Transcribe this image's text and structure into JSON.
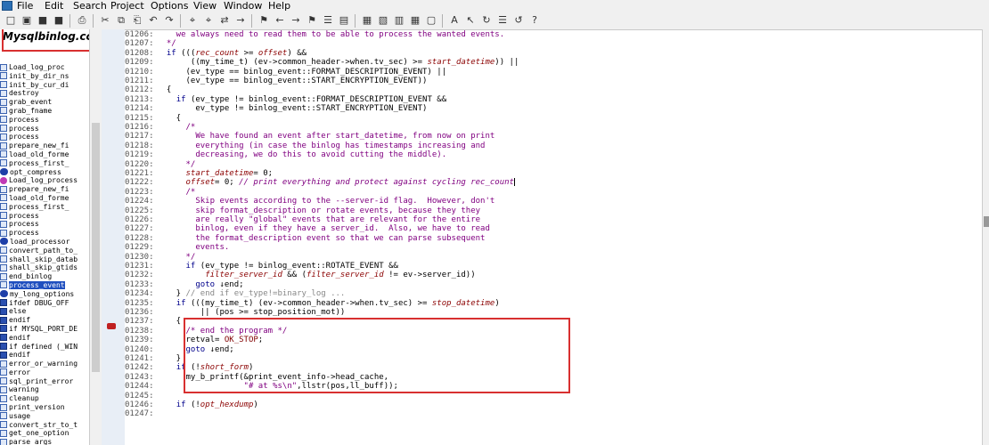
{
  "menu": [
    "File",
    "Edit",
    "Search",
    "Project",
    "Options",
    "View",
    "Window",
    "Help"
  ],
  "file_title": "Mysqlbinlog.cc",
  "sidebar_items": [
    {
      "label": "Load_log_proc",
      "kind": "blue"
    },
    {
      "label": "init_by_dir_ns",
      "kind": "blue"
    },
    {
      "label": "init_by_cur_di",
      "kind": "blue"
    },
    {
      "label": "destroy",
      "kind": "blue"
    },
    {
      "label": "grab_event",
      "kind": "blue"
    },
    {
      "label": "grab_fname",
      "kind": "blue"
    },
    {
      "label": "process",
      "kind": "blue"
    },
    {
      "label": "process",
      "kind": "blue"
    },
    {
      "label": "process",
      "kind": "blue"
    },
    {
      "label": "prepare_new_fi",
      "kind": "blue"
    },
    {
      "label": "load_old_forme",
      "kind": "blue"
    },
    {
      "label": "process_first_",
      "kind": "blue"
    },
    {
      "label": "opt_compress",
      "kind": "oval"
    },
    {
      "label": "Load_log_process",
      "kind": "purple"
    },
    {
      "label": "prepare_new_fi",
      "kind": "blue"
    },
    {
      "label": "load_old_forme",
      "kind": "blue"
    },
    {
      "label": "process_first_",
      "kind": "blue"
    },
    {
      "label": "process",
      "kind": "blue"
    },
    {
      "label": "process",
      "kind": "blue"
    },
    {
      "label": "process",
      "kind": "blue"
    },
    {
      "label": "load_processor",
      "kind": "oval"
    },
    {
      "label": "convert_path_to_",
      "kind": "blue"
    },
    {
      "label": "shall_skip_datab",
      "kind": "blue"
    },
    {
      "label": "shall_skip_gtids",
      "kind": "blue"
    },
    {
      "label": "end_binlog",
      "kind": "blue"
    },
    {
      "label": "process_event",
      "kind": "blue",
      "selected": true
    },
    {
      "label": "my_long_options",
      "kind": "oval"
    },
    {
      "label": "ifdef DBUG_OFF",
      "kind": "hash"
    },
    {
      "label": "else",
      "kind": "hash"
    },
    {
      "label": "endif",
      "kind": "hash"
    },
    {
      "label": "if MYSQL_PORT_DE",
      "kind": "hash"
    },
    {
      "label": "endif",
      "kind": "hash"
    },
    {
      "label": "if defined (_WIN",
      "kind": "hash"
    },
    {
      "label": "endif",
      "kind": "hash"
    },
    {
      "label": "error_or_warning",
      "kind": "blue"
    },
    {
      "label": "error",
      "kind": "blue"
    },
    {
      "label": "sql_print_error",
      "kind": "blue"
    },
    {
      "label": "warning",
      "kind": "blue"
    },
    {
      "label": "cleanup",
      "kind": "blue"
    },
    {
      "label": "print_version",
      "kind": "blue"
    },
    {
      "label": "usage",
      "kind": "blue"
    },
    {
      "label": "convert_str_to_t",
      "kind": "blue"
    },
    {
      "label": "get_one_option",
      "kind": "blue"
    },
    {
      "label": "parse_args",
      "kind": "blue"
    }
  ],
  "code_lines": [
    {
      "n": "01206:",
      "html": "    we always need to read them to be able to process the wanted events.",
      "cls": "cm"
    },
    {
      "n": "01207:",
      "html": "  */",
      "cls": "cm"
    },
    {
      "n": "01208:",
      "html": "  <span class=\"tok-kw\">if</span> (((<span class=\"tok-var\">rec_count</span> >= <span class=\"tok-var\">offset</span>) &&"
    },
    {
      "n": "01209:",
      "html": "       ((my_time_t) (ev->common_header->when.tv_sec) >= <span class=\"tok-var\">start_datetime</span>)) ||"
    },
    {
      "n": "01210:",
      "html": "      (ev_type == binlog_event::FORMAT_DESCRIPTION_EVENT) ||"
    },
    {
      "n": "01211:",
      "html": "      (ev_type == binlog_event::START_ENCRYPTION_EVENT))"
    },
    {
      "n": "01212:",
      "html": "  {"
    },
    {
      "n": "01213:",
      "html": "    <span class=\"tok-kw\">if</span> (ev_type != binlog_event::FORMAT_DESCRIPTION_EVENT &&"
    },
    {
      "n": "01214:",
      "html": "        ev_type != binlog_event::START_ENCRYPTION_EVENT)"
    },
    {
      "n": "01215:",
      "html": "    {"
    },
    {
      "n": "01216:",
      "html": "      /*",
      "cls": "cm"
    },
    {
      "n": "01217:",
      "html": "        We have found an event after start_datetime, from now on print",
      "cls": "cm"
    },
    {
      "n": "01218:",
      "html": "        everything (in case the binlog has timestamps increasing and",
      "cls": "cm"
    },
    {
      "n": "01219:",
      "html": "        decreasing, we do this to avoid cutting the middle).",
      "cls": "cm"
    },
    {
      "n": "01220:",
      "html": "      */",
      "cls": "cm"
    },
    {
      "n": "01221:",
      "html": "      <span class=\"tok-var\">start_datetime</span>= 0;"
    },
    {
      "n": "01222:",
      "html": "      <span class=\"tok-var\">offset</span>= 0; <span class=\"tok-cm\" style=\"font-style:italic\">// print everything and protect against cycling rec_count</span><span class=\"cursor\"></span>"
    },
    {
      "n": "01223:",
      "html": "      /*",
      "cls": "cm"
    },
    {
      "n": "01224:",
      "html": "        Skip events according to the --server-id flag.  However, don't",
      "cls": "cm"
    },
    {
      "n": "01225:",
      "html": "        skip format_description or rotate events, because they they",
      "cls": "cm"
    },
    {
      "n": "01226:",
      "html": "        are really \"global\" events that are relevant for the entire",
      "cls": "cm"
    },
    {
      "n": "01227:",
      "html": "        binlog, even if they have a server_id.  Also, we have to read",
      "cls": "cm"
    },
    {
      "n": "01228:",
      "html": "        the format_description event so that we can parse subsequent",
      "cls": "cm"
    },
    {
      "n": "01229:",
      "html": "        events.",
      "cls": "cm"
    },
    {
      "n": "01230:",
      "html": "      */",
      "cls": "cm"
    },
    {
      "n": "01231:",
      "html": "      <span class=\"tok-kw\">if</span> (ev_type != binlog_event::ROTATE_EVENT &&"
    },
    {
      "n": "01232:",
      "html": "          <span class=\"tok-var\">filter_server_id</span> && (<span class=\"tok-var\">filter_server_id</span> != ev->server_id))"
    },
    {
      "n": "01233:",
      "html": "        <span class=\"tok-kw\">goto</span> ↓end;"
    },
    {
      "n": "01234:",
      "html": "    } <span style=\"color:#888\">// end if ev_type!=binary_log ...</span>"
    },
    {
      "n": "01235:",
      "html": "    <span class=\"tok-kw\">if</span> (((my_time_t) (ev->common_header->when.tv_sec) >= <span class=\"tok-var\">stop_datetime</span>)"
    },
    {
      "n": "01236:",
      "html": "         || (pos >= stop_position_mot))"
    },
    {
      "n": "01237:",
      "html": "    {"
    },
    {
      "n": "01238:",
      "html": "      <span class=\"tok-cm\">/* end the program */</span>"
    },
    {
      "n": "01239:",
      "html": "      retval= <span class=\"tok-const\">OK_STOP</span>;"
    },
    {
      "n": "01240:",
      "html": "      <span class=\"tok-kw\">goto</span> ↓end;"
    },
    {
      "n": "01241:",
      "html": "    }"
    },
    {
      "n": "01242:",
      "html": "    <span class=\"tok-kw\">if</span> (!<span class=\"tok-var\">short_form</span>)"
    },
    {
      "n": "01243:",
      "html": "      my_b_printf(&print_event_info->head_cache,"
    },
    {
      "n": "01244:",
      "html": "                  <span class=\"tok-str\">\"# at %s\\n\"</span>,llstr(pos,ll_buff));"
    },
    {
      "n": "01245:",
      "html": ""
    },
    {
      "n": "01246:",
      "html": "    <span class=\"tok-kw\">if</span> (!<span class=\"tok-var\">opt_hexdump</span>)"
    },
    {
      "n": "01247:",
      "html": ""
    }
  ],
  "toolbar_icons": [
    "new-file-icon",
    "open-folder-icon",
    "save-icon",
    "save-all-icon",
    "print-icon",
    "cut-icon",
    "copy-icon",
    "paste-icon",
    "undo-icon",
    "redo-icon",
    "search-icon",
    "search-files-icon",
    "replace-icon",
    "find-next-icon",
    "bookmark-icon",
    "jump-back-icon",
    "jump-forward-icon",
    "bookmark-toggle-icon",
    "bookmark-list-icon",
    "browse-icon",
    "symbol-window-icon",
    "relation-window-icon",
    "layout-icon",
    "tile-icon",
    "window-icon",
    "case-icon",
    "select-icon",
    "sync-icon",
    "project-icon",
    "rebuild-icon",
    "help-icon"
  ],
  "colors": {
    "accent": "#1f4fbf",
    "highlight_box": "#d83030",
    "keyword": "#00008b",
    "variable": "#8b0000",
    "comment": "#800080"
  }
}
